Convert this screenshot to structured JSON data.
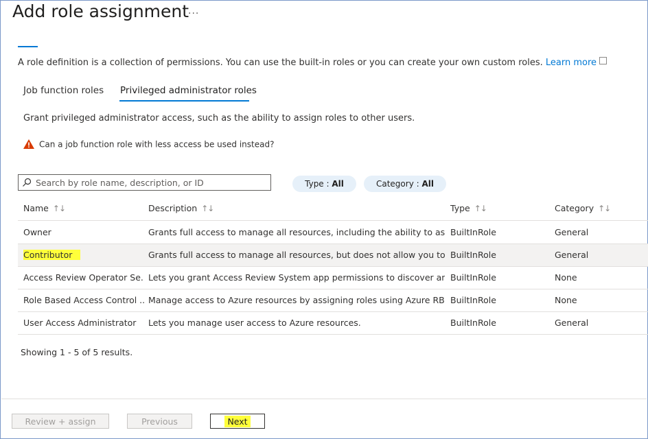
{
  "page": {
    "title": "Add role assignment",
    "more_label": "...",
    "description": "A role definition is a collection of permissions. You can use the built-in roles or you can create your own custom roles.",
    "learn_more": "Learn more"
  },
  "tabs": [
    {
      "label": "Job function roles"
    },
    {
      "label": "Privileged administrator roles"
    }
  ],
  "grant_text": "Grant privileged administrator access, such as the ability to assign roles to other users.",
  "warning_text": "Can a job function role with less access be used instead?",
  "search": {
    "placeholder": "Search by role name, description, or ID"
  },
  "filters": {
    "type_label": "Type : ",
    "type_value": "All",
    "category_label": "Category : ",
    "category_value": "All"
  },
  "table": {
    "columns": [
      "Name",
      "Description",
      "Type",
      "Category"
    ],
    "sort_glyph": "↑↓",
    "rows": [
      {
        "name": "Owner",
        "description": "Grants full access to manage all resources, including the ability to assi...",
        "type": "BuiltInRole",
        "category": "General"
      },
      {
        "name": "Contributor",
        "description": "Grants full access to manage all resources, but does not allow you to ...",
        "type": "BuiltInRole",
        "category": "General"
      },
      {
        "name": "Access Review Operator Se...",
        "description": "Lets you grant Access Review System app permissions to discover and...",
        "type": "BuiltInRole",
        "category": "None"
      },
      {
        "name": "Role Based Access Control ...",
        "description": "Manage access to Azure resources by assigning roles using Azure RB...",
        "type": "BuiltInRole",
        "category": "None"
      },
      {
        "name": "User Access Administrator",
        "description": "Lets you manage user access to Azure resources.",
        "type": "BuiltInRole",
        "category": "General"
      }
    ]
  },
  "results_text": "Showing 1 - 5 of 5 results.",
  "buttons": {
    "review": "Review + assign",
    "previous": "Previous",
    "next": "Next"
  },
  "colors": {
    "accent": "#0078d4",
    "highlight": "#ffff3a",
    "warning": "#d83b01"
  },
  "icons": {
    "search": "search-icon",
    "warning": "warning-icon",
    "external": "external-link-icon"
  }
}
